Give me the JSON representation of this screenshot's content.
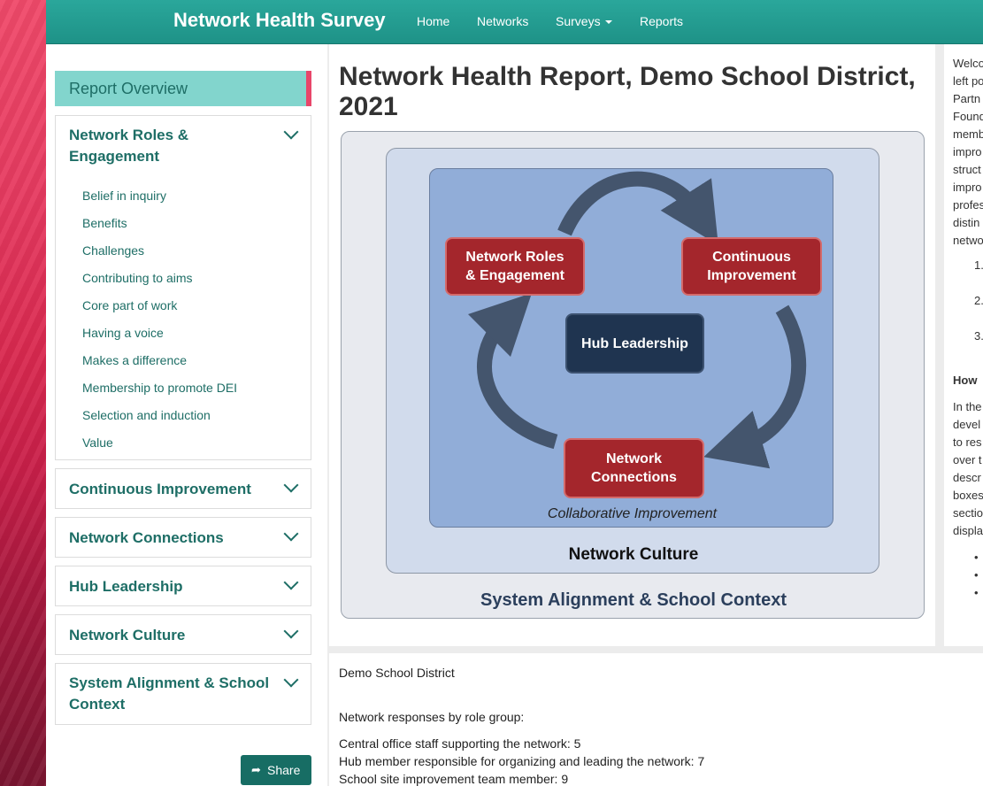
{
  "navbar": {
    "brand": "Network Health Survey",
    "links": [
      "Home",
      "Networks",
      "Surveys",
      "Reports"
    ]
  },
  "sidebar": {
    "overview_label": "Report Overview",
    "sections": [
      {
        "title": "Network Roles & Engagement",
        "title_lines": [
          "Network Roles &",
          "Engagement"
        ],
        "items": [
          "Belief in inquiry",
          "Benefits",
          "Challenges",
          "Contributing to aims",
          "Core part of work",
          "Having a voice",
          "Makes a difference",
          "Membership to promote DEI",
          "Selection and induction",
          "Value"
        ]
      },
      {
        "title": "Continuous Improvement"
      },
      {
        "title": "Network Connections"
      },
      {
        "title": "Hub Leadership"
      },
      {
        "title": "Network Culture"
      },
      {
        "title": "System Alignment & School Context",
        "title_lines": [
          "System Alignment & School",
          "Context"
        ]
      }
    ],
    "share_label": "Share",
    "share_icon": "share-arrow-icon"
  },
  "main": {
    "title": "Network Health Report, Demo School District, 2021",
    "title_lines": [
      "Network Health Report, Demo School District,",
      "2021"
    ]
  },
  "diagram": {
    "roles_lines": [
      "Network Roles",
      "& Engagement"
    ],
    "ci_lines": [
      "Continuous",
      "Improvement"
    ],
    "connections_lines": [
      "Network",
      "Connections"
    ],
    "hub": "Hub Leadership",
    "collab": "Collaborative Improvement",
    "culture": "Network Culture",
    "alignment": "System Alignment & School Context",
    "colors": {
      "red_box": "#a4262c",
      "navy_box": "#1f3450",
      "inner_bg": "#91add8",
      "arrow": "#44556d"
    }
  },
  "summary": {
    "district": "Demo School District",
    "responses_heading": "Network responses by role group:",
    "rows": [
      "Central office staff supporting the network: 5",
      "Hub member responsible for organizing and leading the network: 7",
      "School site improvement team member: 9"
    ]
  },
  "right_panel": {
    "fragments": [
      "Welco",
      "left po",
      "Partn",
      "Found",
      "memb",
      "impro",
      "struct",
      "impro",
      "profes",
      "distin",
      "netwo",
      "1.",
      "2.",
      "3.",
      "How",
      "In the",
      "devel",
      "to res",
      "over t",
      "descr",
      "boxes",
      "sectio",
      "displa",
      "•",
      "•",
      "•"
    ]
  },
  "theme": {
    "teal": "#1e9287",
    "teal_dark": "#176d64",
    "text_teal": "#1e6e66",
    "highlight": "#82d5cd",
    "accent_pink": "#e8466a"
  }
}
